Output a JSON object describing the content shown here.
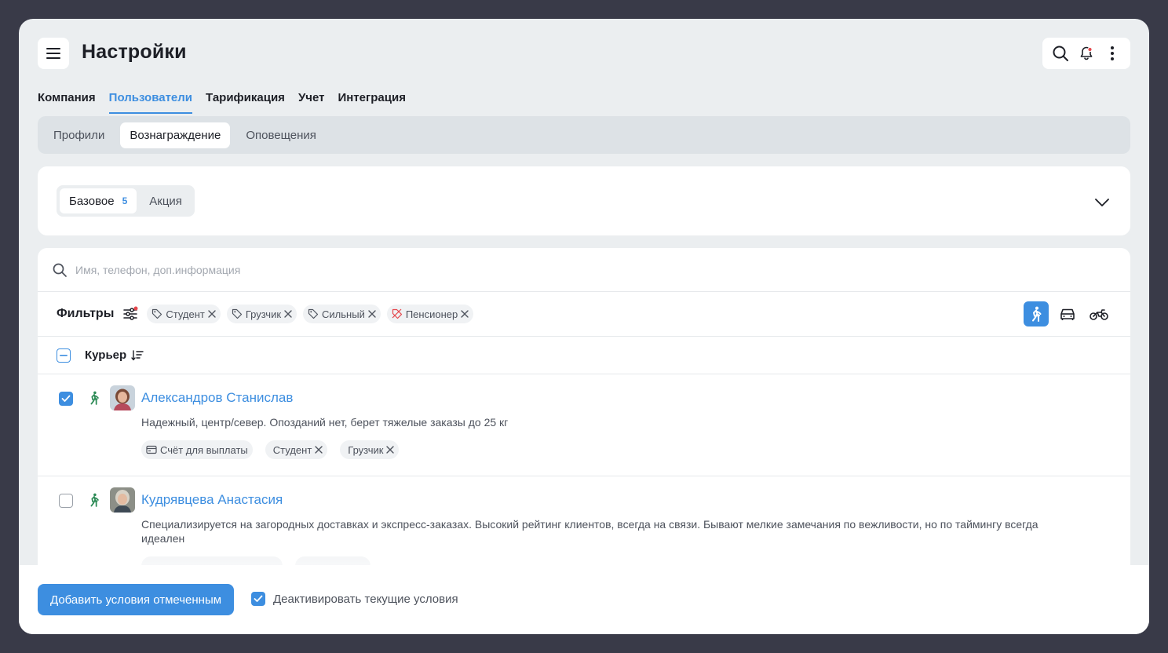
{
  "header": {
    "title": "Настройки"
  },
  "main_tabs": [
    {
      "label": "Компания",
      "active": false
    },
    {
      "label": "Пользователи",
      "active": true
    },
    {
      "label": "Тарификация",
      "active": false
    },
    {
      "label": "Учет",
      "active": false
    },
    {
      "label": "Интеграция",
      "active": false
    }
  ],
  "sub_tabs": [
    {
      "label": "Профили",
      "active": false
    },
    {
      "label": "Вознаграждение",
      "active": true
    },
    {
      "label": "Оповещения",
      "active": false
    }
  ],
  "reward": {
    "segments": [
      {
        "label": "Базовое",
        "count": "5",
        "active": true
      },
      {
        "label": "Акция",
        "active": false
      }
    ]
  },
  "search": {
    "placeholder": "Имя, телефон, доп.информация",
    "value": ""
  },
  "filters": {
    "label": "Фильтры",
    "chips": [
      "Студент",
      "Грузчик",
      "Сильный",
      "Пенсионер"
    ],
    "transport": [
      "walk",
      "car",
      "bike"
    ],
    "transport_active": "walk"
  },
  "list": {
    "column_title": "Курьер",
    "rows": [
      {
        "name": "Александров Станислав",
        "description": "Надежный, центр/север. Опозданий нет, берет тяжелые заказы до 25 кг",
        "checked": true,
        "tags": [
          "Счёт для выплаты",
          "Студент",
          "Грузчик"
        ]
      },
      {
        "name": "Кудрявцева Анастасия",
        "description": "Специализируется на загородных доставках и экспресс-заказах. Высокий рейтинг клиентов, всегда на связи. Бывают мелкие замечания по вежливости, но по таймингу всегда идеален",
        "checked": false,
        "tags": []
      }
    ]
  },
  "footer": {
    "primary_label": "Добавить условия отмеченным",
    "deactivate_label": "Деактивировать текущие условия",
    "deactivate_checked": true
  },
  "colors": {
    "accent": "#3d8ee0",
    "background": "#ebeef0",
    "walk_icon": "#2e8b57"
  }
}
